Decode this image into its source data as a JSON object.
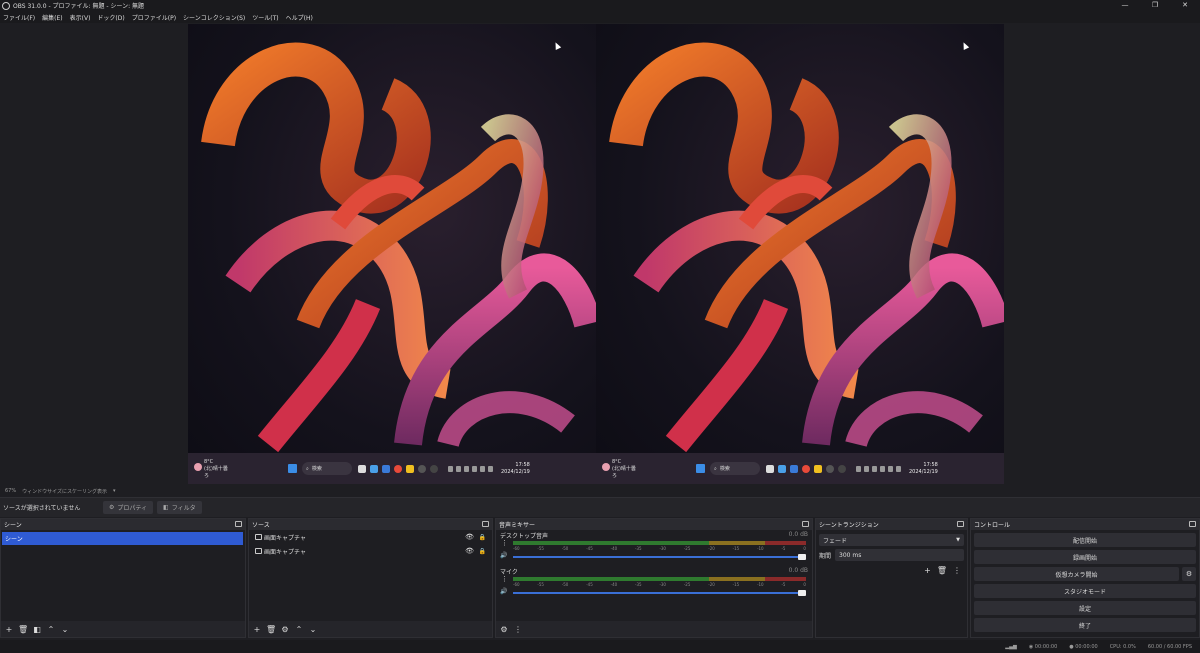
{
  "window": {
    "title": "OBS 31.0.0 - プロファイル: 無題 - シーン: 無題",
    "controls": [
      "—",
      "❐",
      "✕"
    ]
  },
  "menu": [
    "ファイル(F)",
    "編集(E)",
    "表示(V)",
    "ドック(D)",
    "プロファイル(P)",
    "シーンコレクション(S)",
    "ツール(T)",
    "ヘルプ(H)"
  ],
  "preview": {
    "taskbar": {
      "weather_temp": "8°C",
      "weather_desc": "(北)晴十曇ろ",
      "search": "検索",
      "time": "17:58",
      "date": "2024/12/19"
    }
  },
  "scale": {
    "zoom": "67%",
    "mode": "ウィンドウサイズにスケーリング表示"
  },
  "toolbar": {
    "no_source": "ソースが選択されていません",
    "properties": "プロパティ",
    "filters": "フィルタ"
  },
  "scenes": {
    "title": "シーン",
    "items": [
      "シーン"
    ]
  },
  "sources": {
    "title": "ソース",
    "items": [
      "画面キャプチャ",
      "画面キャプチャ"
    ]
  },
  "mixer": {
    "title": "音声ミキサー",
    "channels": [
      {
        "name": "デスクトップ音声",
        "db": "0.0 dB"
      },
      {
        "name": "マイク",
        "db": "0.0 dB"
      }
    ],
    "scale": [
      "-60",
      "-55",
      "-50",
      "-45",
      "-40",
      "-35",
      "-30",
      "-25",
      "-20",
      "-15",
      "-10",
      "-5",
      "0"
    ]
  },
  "transitions": {
    "title": "シーントランジション",
    "selected": "フェード",
    "duration_label": "期間",
    "duration": "300 ms"
  },
  "controls": {
    "title": "コントロール",
    "stream": "配信開始",
    "record": "録画開始",
    "virtual_cam": "仮想カメラ開始",
    "studio": "スタジオモード",
    "settings": "設定",
    "exit": "終了"
  },
  "status": {
    "stream_time": "00:00:00",
    "rec_time": "00:00:00",
    "cpu": "CPU: 0.0%",
    "fps": "60.00 / 60.00 FPS"
  }
}
